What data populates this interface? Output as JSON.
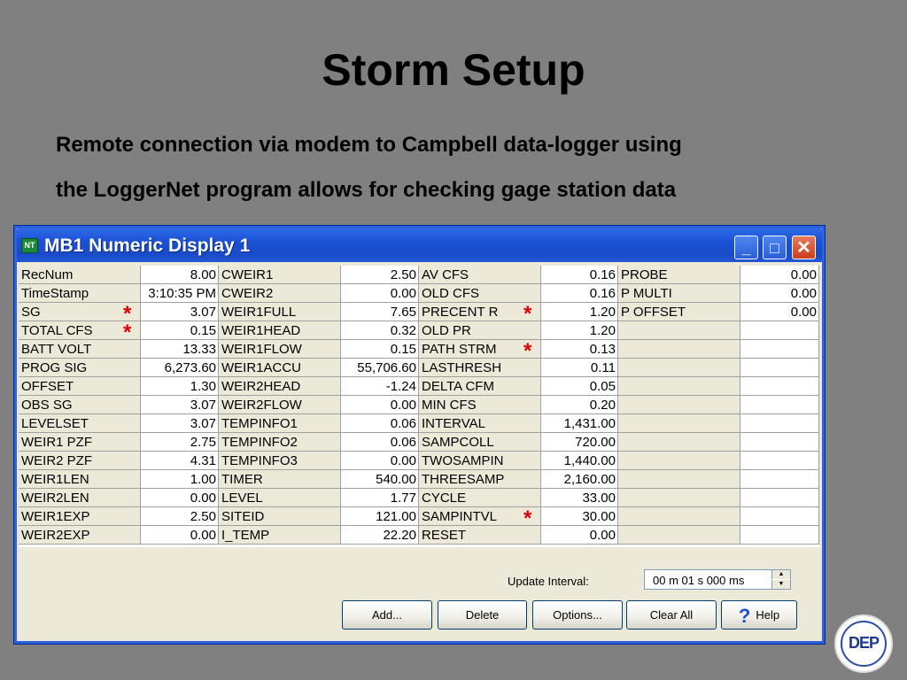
{
  "slide": {
    "title": "Storm Setup",
    "subtitle_line1": "Remote connection via modem to Campbell data-logger using",
    "subtitle_line2": "the LoggerNet program allows for checking gage station data"
  },
  "window": {
    "title": "MB1 Numeric Display 1",
    "icon_label": "NT",
    "minimize": "_",
    "maximize": "□",
    "close": "✕"
  },
  "star_symbol": "*",
  "table": {
    "columns": [
      {
        "rows": [
          {
            "label": "RecNum",
            "value": "8.00"
          },
          {
            "label": "TimeStamp",
            "value": "3:10:35 PM"
          },
          {
            "label": "SG",
            "value": "3.07",
            "star": true
          },
          {
            "label": "TOTAL CFS",
            "value": "0.15",
            "star": true
          },
          {
            "label": "BATT VOLT",
            "value": "13.33"
          },
          {
            "label": "PROG SIG",
            "value": "6,273.60"
          },
          {
            "label": "OFFSET",
            "value": "1.30"
          },
          {
            "label": "OBS SG",
            "value": "3.07"
          },
          {
            "label": "LEVELSET",
            "value": "3.07"
          },
          {
            "label": "WEIR1 PZF",
            "value": "2.75"
          },
          {
            "label": "WEIR2 PZF",
            "value": "4.31"
          },
          {
            "label": "WEIR1LEN",
            "value": "1.00"
          },
          {
            "label": "WEIR2LEN",
            "value": "0.00"
          },
          {
            "label": "WEIR1EXP",
            "value": "2.50"
          },
          {
            "label": "WEIR2EXP",
            "value": "0.00"
          }
        ]
      },
      {
        "rows": [
          {
            "label": "CWEIR1",
            "value": "2.50"
          },
          {
            "label": "CWEIR2",
            "value": "0.00"
          },
          {
            "label": "WEIR1FULL",
            "value": "7.65"
          },
          {
            "label": "WEIR1HEAD",
            "value": "0.32"
          },
          {
            "label": "WEIR1FLOW",
            "value": "0.15"
          },
          {
            "label": "WEIR1ACCU",
            "value": "55,706.60"
          },
          {
            "label": "WEIR2HEAD",
            "value": "-1.24"
          },
          {
            "label": "WEIR2FLOW",
            "value": "0.00"
          },
          {
            "label": "TEMPINFO1",
            "value": "0.06"
          },
          {
            "label": "TEMPINFO2",
            "value": "0.06"
          },
          {
            "label": "TEMPINFO3",
            "value": "0.00"
          },
          {
            "label": "TIMER",
            "value": "540.00"
          },
          {
            "label": "LEVEL",
            "value": "1.77"
          },
          {
            "label": "SITEID",
            "value": "121.00"
          },
          {
            "label": "I_TEMP",
            "value": "22.20"
          }
        ]
      },
      {
        "rows": [
          {
            "label": "AV CFS",
            "value": "0.16"
          },
          {
            "label": "OLD CFS",
            "value": "0.16"
          },
          {
            "label": "PRECENT R",
            "value": "1.20",
            "star": true
          },
          {
            "label": "OLD PR",
            "value": "1.20"
          },
          {
            "label": "PATH STRM",
            "value": "0.13",
            "star": true
          },
          {
            "label": "LASTHRESH",
            "value": "0.11"
          },
          {
            "label": "DELTA CFM",
            "value": "0.05"
          },
          {
            "label": "MIN CFS",
            "value": "0.20"
          },
          {
            "label": "INTERVAL",
            "value": "1,431.00"
          },
          {
            "label": "SAMPCOLL",
            "value": "720.00"
          },
          {
            "label": "TWOSAMPIN",
            "value": "1,440.00"
          },
          {
            "label": "THREESAMP",
            "value": "2,160.00"
          },
          {
            "label": "CYCLE",
            "value": "33.00"
          },
          {
            "label": "SAMPINTVL",
            "value": "30.00",
            "star": true
          },
          {
            "label": "RESET",
            "value": "0.00"
          }
        ]
      },
      {
        "rows": [
          {
            "label": "PROBE",
            "value": "0.00"
          },
          {
            "label": "P MULTI",
            "value": "0.00"
          },
          {
            "label": "P OFFSET",
            "value": "0.00"
          },
          {
            "label": "",
            "value": ""
          },
          {
            "label": "",
            "value": ""
          },
          {
            "label": "",
            "value": ""
          },
          {
            "label": "",
            "value": ""
          },
          {
            "label": "",
            "value": ""
          },
          {
            "label": "",
            "value": ""
          },
          {
            "label": "",
            "value": ""
          },
          {
            "label": "",
            "value": ""
          },
          {
            "label": "",
            "value": ""
          },
          {
            "label": "",
            "value": ""
          },
          {
            "label": "",
            "value": ""
          },
          {
            "label": "",
            "value": ""
          }
        ]
      }
    ]
  },
  "controls": {
    "update_interval_label": "Update Interval:",
    "update_interval_value": "00 m 01 s 000 ms",
    "spin_up": "▲",
    "spin_down": "▼"
  },
  "buttons": {
    "add": "Add...",
    "delete": "Delete",
    "options": "Options...",
    "clear_all": "Clear All",
    "help_icon": "?",
    "help": "Help"
  },
  "logo": {
    "text": "DEP"
  },
  "colors": {
    "background": "#808080",
    "title_bar": "#1b50d4",
    "star": "#e00000"
  }
}
